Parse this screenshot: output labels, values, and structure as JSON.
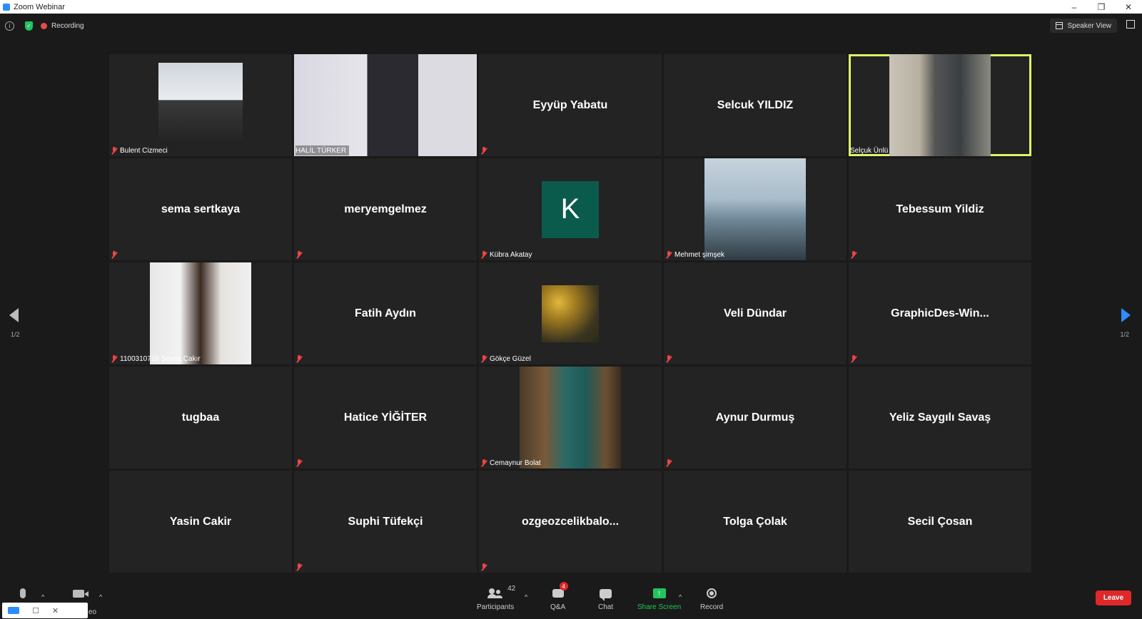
{
  "window": {
    "title": "Zoom Webinar",
    "minimize": "–",
    "restore": "❐",
    "close": "✕"
  },
  "topbar": {
    "info_glyph": "i",
    "shield_glyph": "✓",
    "recording_label": "Recording",
    "speaker_view_label": "Speaker View"
  },
  "colors": {
    "accent": "#2d8cff",
    "active_speaker": "#e1f26a",
    "mic_off": "#e44444",
    "leave": "#e02828",
    "share": "#23c45e"
  },
  "tiles": [
    {
      "name": "Bulent Cizmeci",
      "type": "video",
      "muted": true
    },
    {
      "name": "HALİL TÜRKER",
      "type": "video",
      "muted": false
    },
    {
      "name": "Eyyüp Yabatu",
      "type": "name",
      "muted": true
    },
    {
      "name": "Selcuk YILDIZ",
      "type": "name",
      "muted": false
    },
    {
      "name": "Selçuk Ünlü",
      "type": "video",
      "muted": false,
      "active": true
    },
    {
      "name": "sema sertkaya",
      "type": "name",
      "muted": true
    },
    {
      "name": "meryemgelmez",
      "type": "name",
      "muted": true
    },
    {
      "name": "Kübra Akatay",
      "type": "avatar",
      "letter": "K",
      "muted": true
    },
    {
      "name": "Mehmet şimşek",
      "type": "video",
      "muted": true
    },
    {
      "name": "Tebessum Yildiz",
      "type": "name",
      "muted": true
    },
    {
      "name": "1100310718 Şeyda Çakır",
      "type": "video",
      "muted": true
    },
    {
      "name": "Fatih Aydın",
      "type": "name",
      "muted": true
    },
    {
      "name": "Gökçe Güzel",
      "type": "photo",
      "muted": true
    },
    {
      "name": "Veli Dündar",
      "type": "name",
      "muted": true
    },
    {
      "name": "GraphicDes-Win...",
      "type": "name",
      "muted": true
    },
    {
      "name": "tugbaa",
      "type": "name",
      "muted": false
    },
    {
      "name": "Hatice YİĞİTER",
      "type": "name",
      "muted": true
    },
    {
      "name": "Cemaynur Bolat",
      "type": "video",
      "muted": true
    },
    {
      "name": "Aynur Durmuş",
      "type": "name",
      "muted": true
    },
    {
      "name": "Yeliz Saygılı Savaş",
      "type": "name",
      "muted": false
    },
    {
      "name": "Yasin Cakir",
      "type": "name",
      "muted": false
    },
    {
      "name": "Suphi Tüfekçi",
      "type": "name",
      "muted": true
    },
    {
      "name": "ozgeozcelikbalo...",
      "type": "name",
      "muted": true
    },
    {
      "name": "Tolga Çolak",
      "type": "name",
      "muted": false
    },
    {
      "name": "Secil Çosan",
      "type": "name",
      "muted": false
    }
  ],
  "pagination": {
    "left": "1/2",
    "right": "1/2"
  },
  "toolbar": {
    "caret": "^",
    "participants_label": "Participants",
    "participants_count": "42",
    "qa_label": "Q&A",
    "qa_badge": "4",
    "chat_label": "Chat",
    "share_label": "Share Screen",
    "share_glyph": "↑",
    "record_label": "Record",
    "leave_label": "Leave",
    "video_label_partial": "eo"
  },
  "mini_window": {
    "restore": "☐",
    "close": "✕"
  }
}
